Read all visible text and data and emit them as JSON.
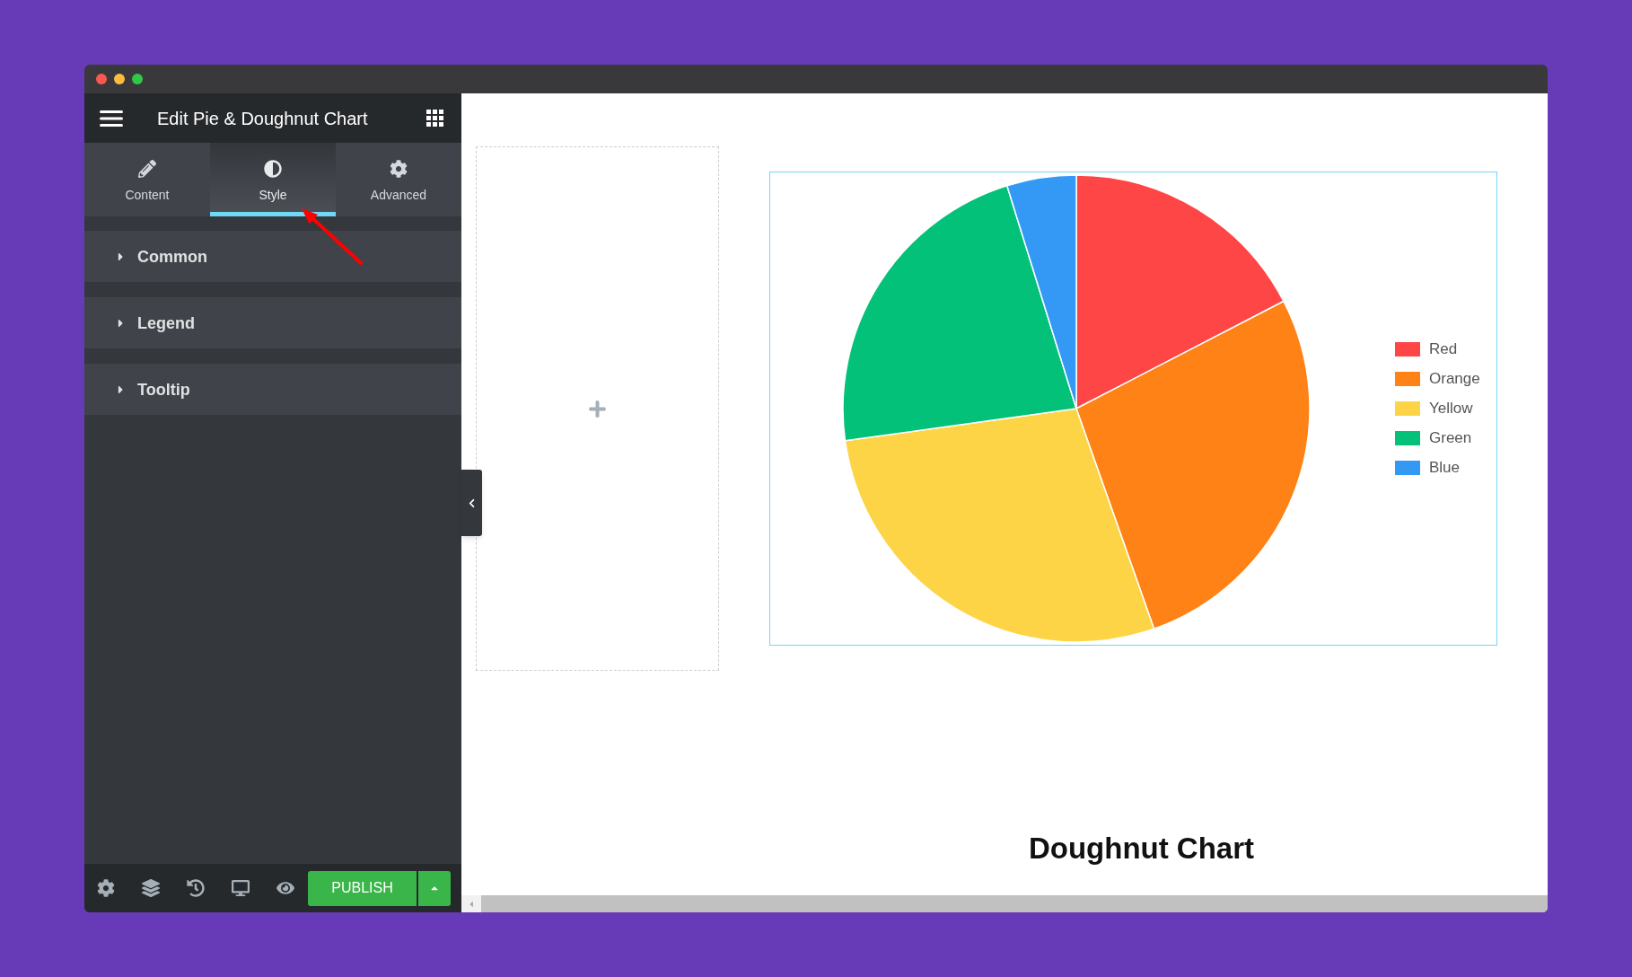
{
  "sidebar": {
    "title": "Edit Pie & Doughnut Chart",
    "tabs": [
      {
        "label": "Content",
        "selected": false
      },
      {
        "label": "Style",
        "selected": true
      },
      {
        "label": "Advanced",
        "selected": false
      }
    ],
    "sections": [
      {
        "label": "Common",
        "expanded": false
      },
      {
        "label": "Legend",
        "expanded": false
      },
      {
        "label": "Tooltip",
        "expanded": false
      }
    ],
    "publish_button": "PUBLISH"
  },
  "canvas": {
    "chart_data": {
      "type": "pie",
      "categories": [
        "Red",
        "Orange",
        "Yellow",
        "Green",
        "Blue"
      ],
      "values": [
        17.4,
        27.2,
        28.2,
        22.4,
        4.8
      ],
      "colors": [
        "#ff4646",
        "#fe8216",
        "#fed447",
        "#04c17a",
        "#3498f5"
      ],
      "legend": "right"
    },
    "title": "Doughnut Chart"
  }
}
